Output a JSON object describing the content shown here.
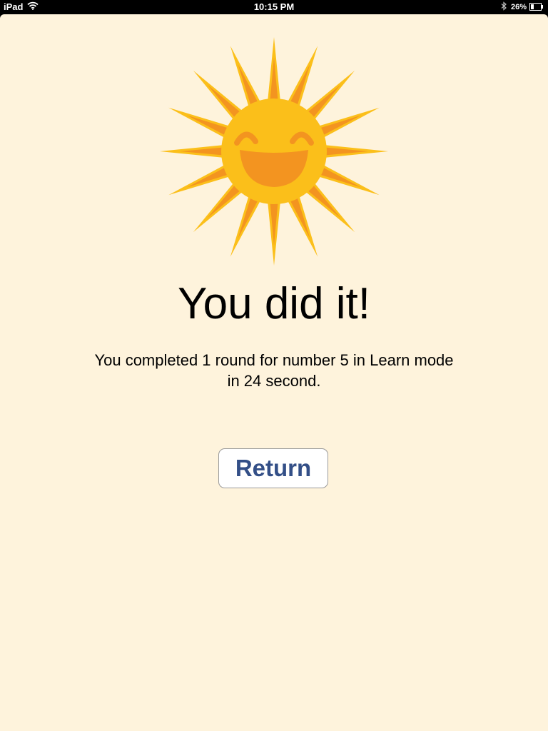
{
  "status_bar": {
    "carrier": "iPad",
    "time": "10:15 PM",
    "battery_percent": "26%",
    "icons": [
      "wifi-icon",
      "bluetooth-icon",
      "battery-icon"
    ]
  },
  "main": {
    "illustration": "smiling-sun",
    "headline": "You did it!",
    "message_line1": "You completed 1 round for number 5 in Learn mode",
    "message_line2": "in 24 second.",
    "return_label": "Return"
  },
  "colors": {
    "background": "#fef3dc",
    "sun_yellow": "#fbbf1a",
    "sun_orange": "#f39420",
    "button_text": "#334f87"
  }
}
